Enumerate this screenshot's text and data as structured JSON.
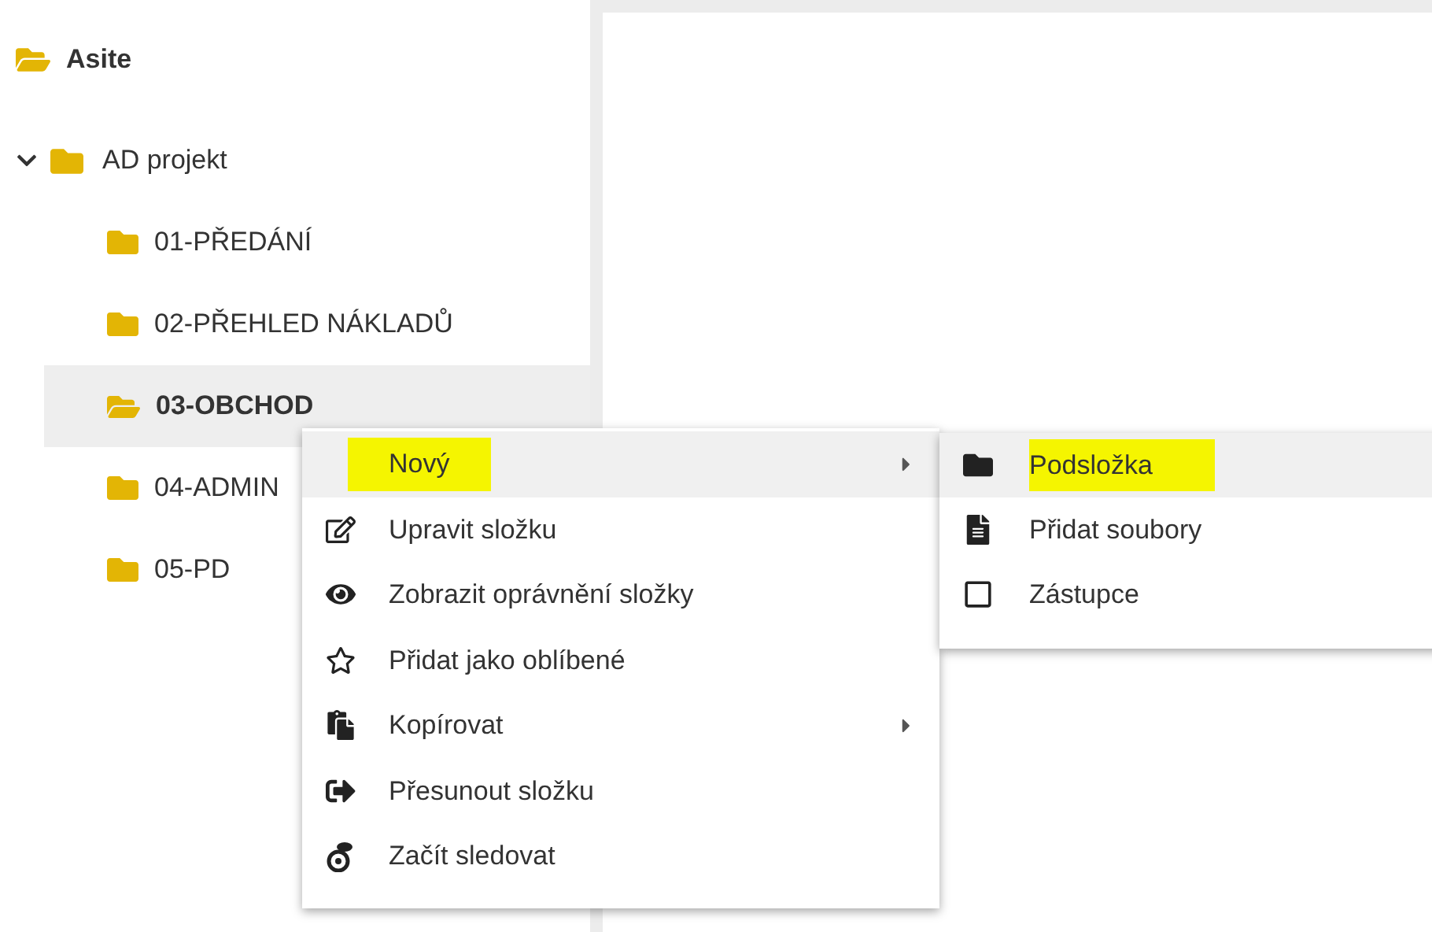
{
  "tree": {
    "root": {
      "label": "Asite"
    },
    "items": [
      {
        "label": "AD projekt",
        "expanded": true,
        "children": [
          {
            "label": "01-PŘEDÁNÍ",
            "selected": false
          },
          {
            "label": "02-PŘEHLED NÁKLADŮ",
            "selected": false
          },
          {
            "label": "03-OBCHOD",
            "selected": true
          },
          {
            "label": "04-ADMIN",
            "selected": false
          },
          {
            "label": "05-PD",
            "selected": false
          }
        ]
      }
    ]
  },
  "context_menu": {
    "items": [
      {
        "label": "Nový",
        "selected": true,
        "highlighted": true,
        "submenu": true
      },
      {
        "label": "Upravit složku",
        "selected": false,
        "highlighted": false,
        "submenu": false
      },
      {
        "label": "Zobrazit oprávnění složky",
        "selected": false,
        "highlighted": false,
        "submenu": false
      },
      {
        "label": "Přidat jako oblíbené",
        "selected": false,
        "highlighted": false,
        "submenu": false
      },
      {
        "label": "Kopírovat",
        "selected": false,
        "highlighted": false,
        "submenu": true
      },
      {
        "label": "Přesunout složku",
        "selected": false,
        "highlighted": false,
        "submenu": false
      },
      {
        "label": "Začít sledovat",
        "selected": false,
        "highlighted": false,
        "submenu": false
      }
    ]
  },
  "submenu": {
    "items": [
      {
        "label": "Podsložka",
        "selected": true,
        "highlighted": true
      },
      {
        "label": "Přidat soubory",
        "selected": false,
        "highlighted": false
      },
      {
        "label": "Zástupce",
        "selected": false,
        "highlighted": false
      }
    ]
  }
}
